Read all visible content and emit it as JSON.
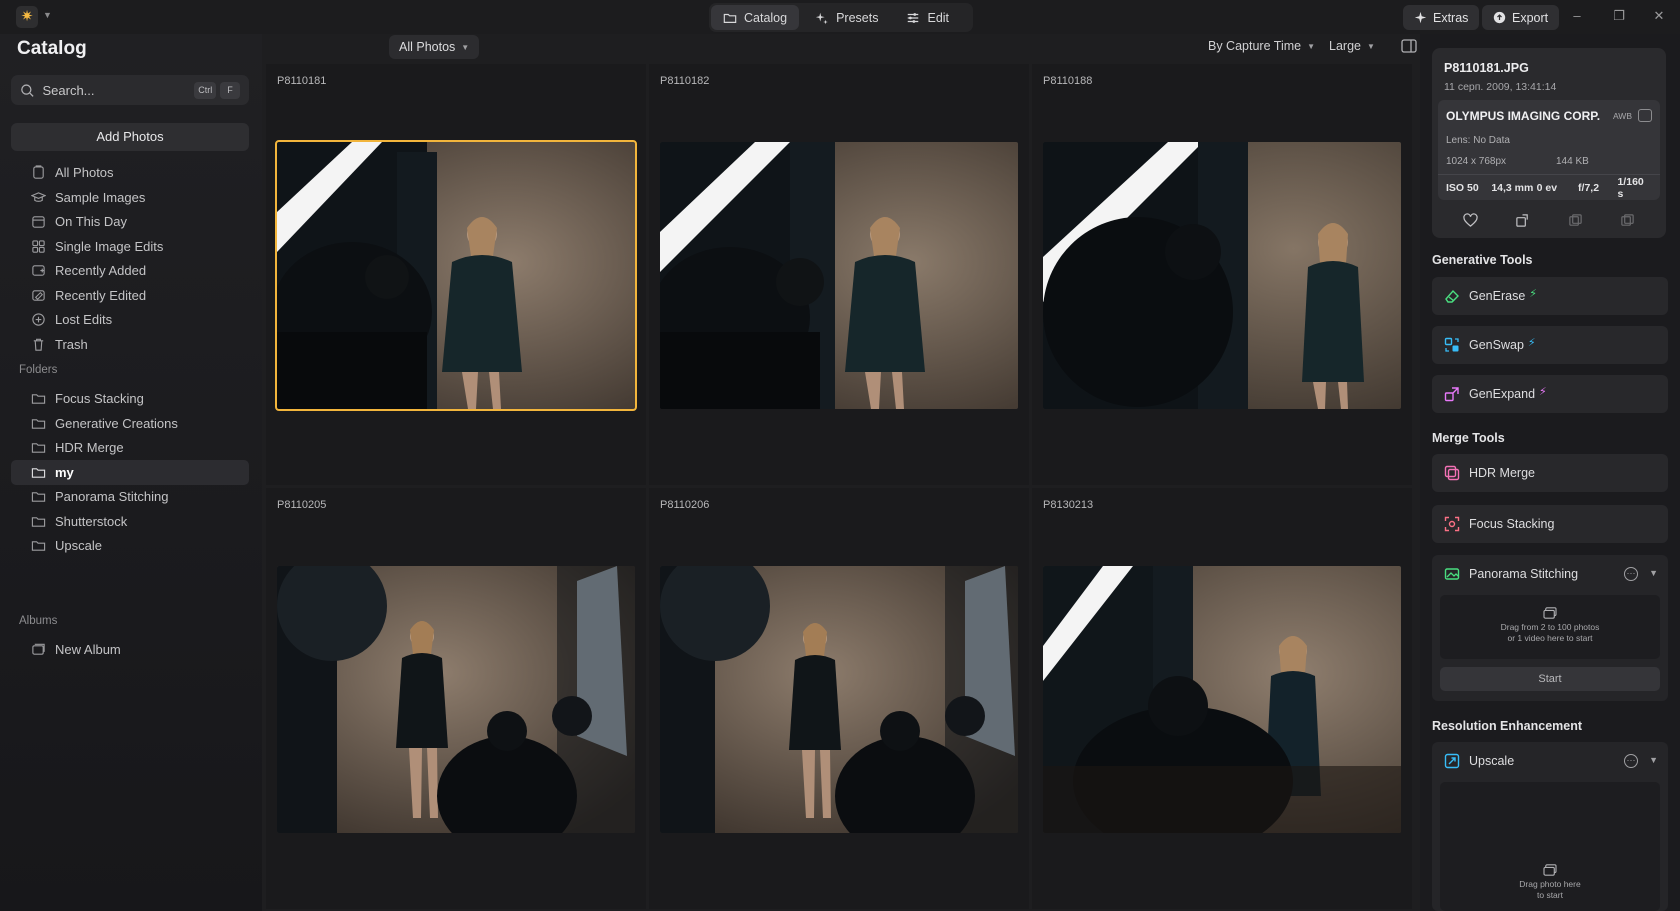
{
  "topbar": {
    "tabs": [
      {
        "label": "Catalog",
        "icon": "folder-icon",
        "active": true
      },
      {
        "label": "Presets",
        "icon": "sparkle-icon",
        "active": false
      },
      {
        "label": "Edit",
        "icon": "sliders-icon",
        "active": false
      }
    ],
    "extras_label": "Extras",
    "export_label": "Export"
  },
  "sidebar": {
    "title": "Catalog",
    "search_placeholder": "Search...",
    "shortcut_keys": [
      "Ctrl",
      "F"
    ],
    "add_photos_label": "Add Photos",
    "library": [
      {
        "label": "All Photos",
        "icon": "photos-icon"
      },
      {
        "label": "Sample Images",
        "icon": "graduation-icon"
      },
      {
        "label": "On This Day",
        "icon": "calendar-icon"
      },
      {
        "label": "Single Image Edits",
        "icon": "grid-icon"
      },
      {
        "label": "Recently Added",
        "icon": "image-plus-icon"
      },
      {
        "label": "Recently Edited",
        "icon": "image-edit-icon"
      },
      {
        "label": "Lost Edits",
        "icon": "lost-edits-icon"
      },
      {
        "label": "Trash",
        "icon": "trash-icon"
      }
    ],
    "folders_label": "Folders",
    "folders": [
      {
        "label": "Focus Stacking",
        "selected": false
      },
      {
        "label": "Generative Creations",
        "selected": false
      },
      {
        "label": "HDR Merge",
        "selected": false
      },
      {
        "label": "my",
        "selected": true
      },
      {
        "label": "Panorama Stitching",
        "selected": false
      },
      {
        "label": "Shutterstock",
        "selected": false
      },
      {
        "label": "Upscale",
        "selected": false
      }
    ],
    "albums_label": "Albums",
    "albums": [
      {
        "label": "New Album",
        "icon": "album-icon"
      }
    ]
  },
  "toolbar": {
    "filter": "All Photos",
    "sort": "By Capture Time",
    "size": "Large"
  },
  "photos": [
    {
      "name": "P8110181",
      "selected": true
    },
    {
      "name": "P8110182",
      "selected": false
    },
    {
      "name": "P8110188",
      "selected": false
    },
    {
      "name": "P8110205",
      "selected": false
    },
    {
      "name": "P8110206",
      "selected": false
    },
    {
      "name": "P8130213",
      "selected": false
    }
  ],
  "info": {
    "filename": "P8110181.JPG",
    "date": "11 серп. 2009, 13:41:14",
    "camera": "OLYMPUS IMAGING CORP.",
    "wb": "AWB",
    "lens": "Lens: No Data",
    "resolution": "1024 x 768px",
    "filesize": "144 KB",
    "exif": {
      "iso": "ISO 50",
      "focal": "14,3 mm",
      "ev": "0 ev",
      "aperture": "f/7,2",
      "shutter": "1/160 s"
    }
  },
  "generative_tools": {
    "title": "Generative Tools",
    "items": [
      {
        "label": "GenErase",
        "color": "#4ade80"
      },
      {
        "label": "GenSwap",
        "color": "#38bdf8"
      },
      {
        "label": "GenExpand",
        "color": "#e879f9"
      }
    ]
  },
  "merge_tools": {
    "title": "Merge Tools",
    "hdr": "HDR Merge",
    "focus": "Focus Stacking",
    "panorama": {
      "label": "Panorama Stitching",
      "hint_line1": "Drag from 2 to 100 photos",
      "hint_line2": "or 1 video here to start",
      "start_label": "Start"
    }
  },
  "resolution": {
    "title": "Resolution Enhancement",
    "upscale": {
      "label": "Upscale",
      "hint_line1": "Drag photo here",
      "hint_line2": "to start"
    }
  }
}
